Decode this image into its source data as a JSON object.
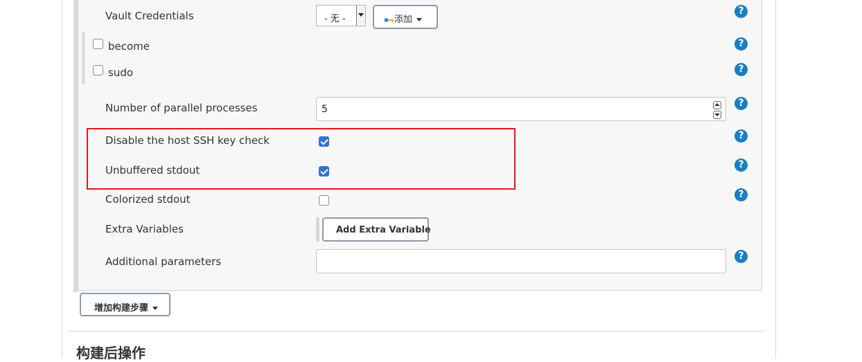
{
  "fields": {
    "vault_credentials": {
      "label": "Vault Credentials",
      "select_value": "- 无 -",
      "add_button_label": "添加"
    },
    "become": {
      "label": "become",
      "checked": false
    },
    "sudo": {
      "label": "sudo",
      "checked": false
    },
    "parallel": {
      "label": "Number of parallel processes",
      "value": "5"
    },
    "disable_ssh_check": {
      "label": "Disable the host SSH key check",
      "checked": true
    },
    "unbuffered_stdout": {
      "label": "Unbuffered stdout",
      "checked": true
    },
    "colorized_stdout": {
      "label": "Colorized stdout",
      "checked": false
    },
    "extra_variables": {
      "label": "Extra Variables",
      "button_label": "Add Extra Variable"
    },
    "additional_parameters": {
      "label": "Additional parameters",
      "value": ""
    }
  },
  "help_symbol": "?",
  "add_build_step_label": "增加构建步骤",
  "post_build_title": "构建后操作",
  "colors": {
    "help": "#1a7ec5",
    "checkbox_checked": "#2f73d5",
    "highlight_border": "#e8141c"
  }
}
